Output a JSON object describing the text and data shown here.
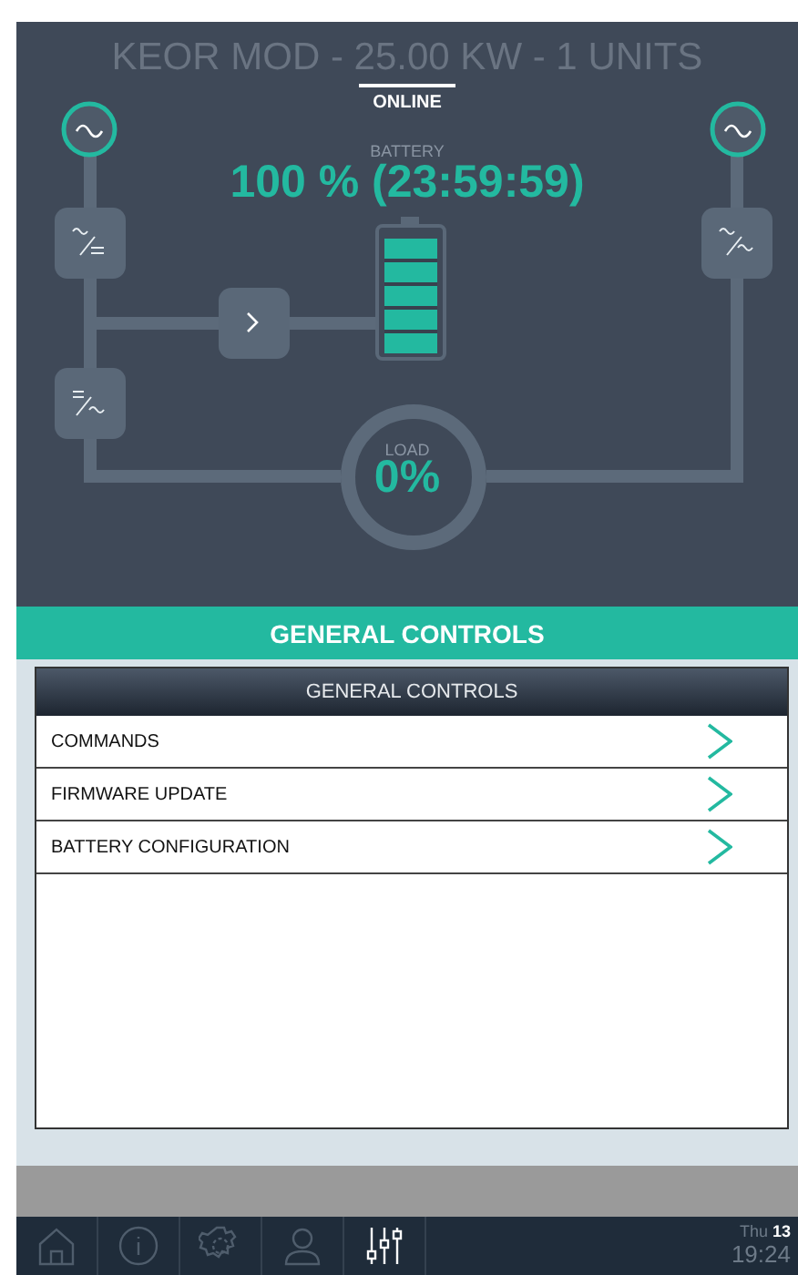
{
  "header": {
    "title": "KEOR MOD - 25.00 KW - 1 UNITS",
    "status": "ONLINE"
  },
  "battery": {
    "label": "BATTERY",
    "reading": "100 % (23:59:59)",
    "level": 1
  },
  "load": {
    "label": "LOAD",
    "reading": "0%"
  },
  "section_bar": {
    "title": "GENERAL CONTROLS"
  },
  "list": {
    "heading": "GENERAL CONTROLS",
    "items": [
      {
        "label": "COMMANDS"
      },
      {
        "label": "FIRMWARE UPDATE"
      },
      {
        "label": "BATTERY CONFIGURATION"
      }
    ]
  },
  "nav": [
    {
      "kind": "home",
      "selected": false
    },
    {
      "kind": "info",
      "selected": false
    },
    {
      "kind": "settings",
      "selected": false
    },
    {
      "kind": "user",
      "selected": false
    },
    {
      "kind": "sliders",
      "selected": true
    }
  ],
  "clock": {
    "day": "Thu",
    "date": "13",
    "time": "19:24"
  }
}
